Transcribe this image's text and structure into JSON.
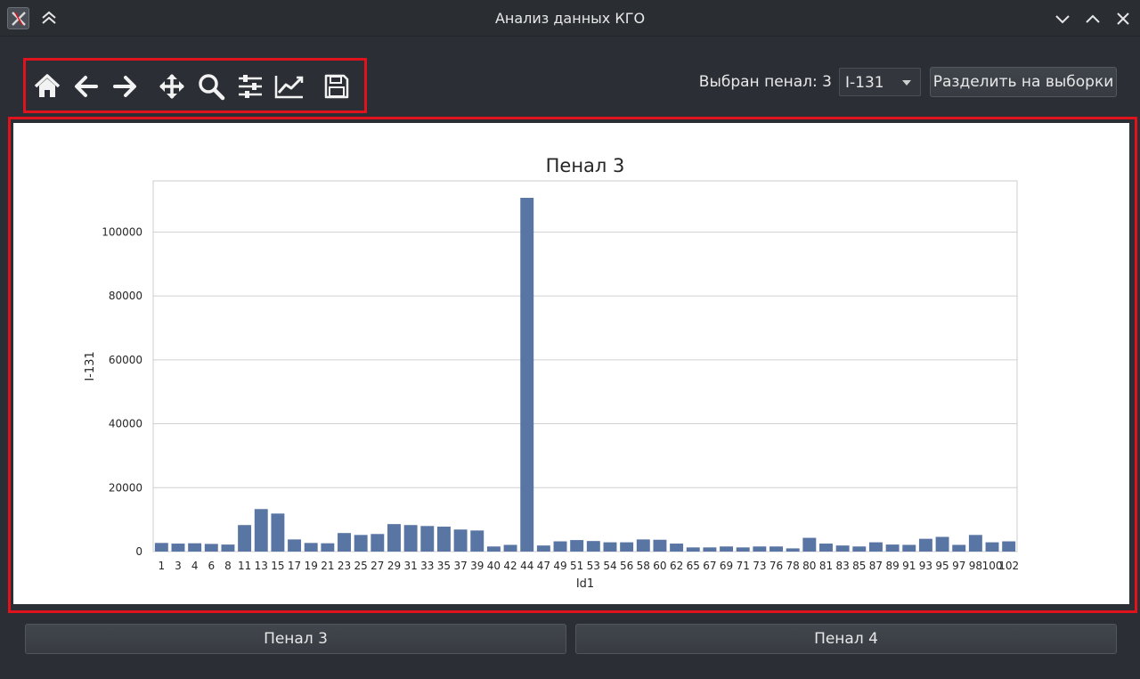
{
  "window": {
    "title": "Анализ данных КГО",
    "icon": "x-app-icon",
    "controls": [
      "shade-icon",
      "minimize-icon",
      "maximize-icon",
      "close-icon"
    ]
  },
  "toolbar": {
    "tools": [
      {
        "name": "home-icon",
        "label": "Home"
      },
      {
        "name": "back-arrow-icon",
        "label": "Back"
      },
      {
        "name": "forward-arrow-icon",
        "label": "Forward"
      },
      {
        "name": "pan-move-icon",
        "label": "Pan"
      },
      {
        "name": "zoom-magnifier-icon",
        "label": "Zoom"
      },
      {
        "name": "subplots-sliders-icon",
        "label": "Configure subplots"
      },
      {
        "name": "axes-lines-icon",
        "label": "Edit axis"
      },
      {
        "name": "save-floppy-icon",
        "label": "Save"
      }
    ],
    "selected_label": "Выбран пенал: 3",
    "combo_value": "I-131",
    "split_button": "Разделить на выборки"
  },
  "highlight_color": "#e0121b",
  "bar_color": "#5875a4",
  "chart_data": {
    "type": "bar",
    "title": "Пенал 3",
    "xlabel": "Id1",
    "ylabel": "I-131",
    "ylim": [
      0,
      116000
    ],
    "yticks": [
      0,
      20000,
      40000,
      60000,
      80000,
      100000
    ],
    "grid": true,
    "categories": [
      "1",
      "3",
      "4",
      "6",
      "8",
      "11",
      "13",
      "15",
      "17",
      "19",
      "21",
      "23",
      "25",
      "27",
      "29",
      "31",
      "33",
      "35",
      "37",
      "39",
      "40",
      "42",
      "44",
      "47",
      "49",
      "51",
      "53",
      "54",
      "56",
      "58",
      "60",
      "62",
      "65",
      "67",
      "69",
      "71",
      "73",
      "76",
      "78",
      "80",
      "81",
      "83",
      "85",
      "87",
      "89",
      "91",
      "93",
      "95",
      "97",
      "98",
      "100",
      "102"
    ],
    "values": [
      2700,
      2500,
      2600,
      2400,
      2200,
      8300,
      13300,
      11900,
      3800,
      2700,
      2600,
      5800,
      5200,
      5500,
      8600,
      8300,
      8000,
      7800,
      6900,
      6600,
      1600,
      2100,
      110700,
      1900,
      3200,
      3600,
      3300,
      2900,
      2900,
      3800,
      3700,
      2500,
      1300,
      1300,
      1600,
      1300,
      1600,
      1600,
      1000,
      4300,
      2500,
      1900,
      1600,
      2900,
      2200,
      2100,
      4000,
      4600,
      2100,
      5200,
      2900,
      3200
    ]
  },
  "bottom_buttons": [
    "Пенал 3",
    "Пенал 4"
  ]
}
